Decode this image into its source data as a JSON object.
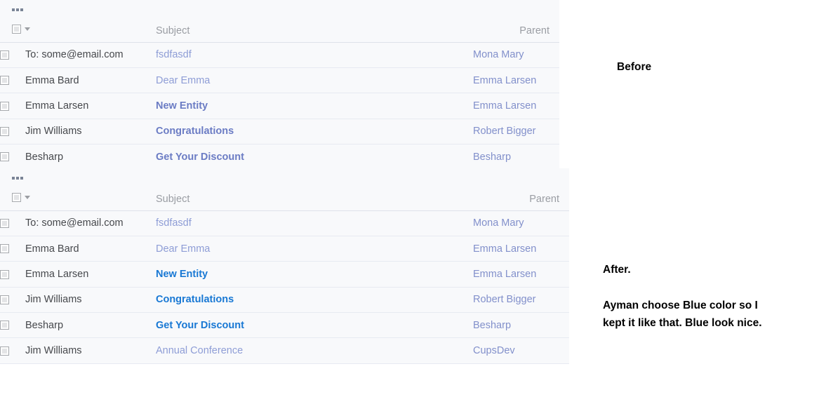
{
  "tables": [
    {
      "id": "before",
      "overflow_icon": "ellipsis-icon",
      "select_all_icon": "checkbox-icon",
      "dropdown_icon": "caret-down-icon",
      "columns": {
        "check": "",
        "from": "",
        "subject": "Subject",
        "parent": "Parent"
      },
      "rows": [
        {
          "from": "To: some@email.com",
          "subject": "fsdfasdf",
          "bold": false,
          "parent": "Mona Mary"
        },
        {
          "from": "Emma Bard",
          "subject": "Dear Emma",
          "bold": false,
          "parent": "Emma Larsen"
        },
        {
          "from": "Emma Larsen",
          "subject": "New Entity",
          "bold": true,
          "parent": "Emma Larsen"
        },
        {
          "from": "Jim Williams",
          "subject": "Congratulations",
          "bold": true,
          "parent": "Robert Bigger"
        },
        {
          "from": "Besharp",
          "subject": "Get Your Discount",
          "bold": true,
          "parent": "Besharp"
        }
      ]
    },
    {
      "id": "after",
      "overflow_icon": "ellipsis-icon",
      "select_all_icon": "checkbox-icon",
      "dropdown_icon": "caret-down-icon",
      "columns": {
        "check": "",
        "from": "",
        "subject": "Subject",
        "parent": "Parent"
      },
      "rows": [
        {
          "from": "To: some@email.com",
          "subject": "fsdfasdf",
          "bold": false,
          "parent": "Mona Mary"
        },
        {
          "from": "Emma Bard",
          "subject": "Dear Emma",
          "bold": false,
          "parent": "Emma Larsen"
        },
        {
          "from": "Emma Larsen",
          "subject": "New Entity",
          "bold": true,
          "parent": "Emma Larsen"
        },
        {
          "from": "Jim Williams",
          "subject": "Congratulations",
          "bold": true,
          "parent": "Robert Bigger"
        },
        {
          "from": "Besharp",
          "subject": "Get Your Discount",
          "bold": true,
          "parent": "Besharp"
        },
        {
          "from": "Jim Williams",
          "subject": "Annual Conference",
          "bold": false,
          "parent": "CupsDev"
        }
      ]
    }
  ],
  "annotations": {
    "before_label": "Before",
    "after_label": "After.",
    "after_note": "Ayman choose Blue color so I kept it like that. Blue look nice."
  },
  "colors": {
    "panel_background": "#f8f9fb",
    "row_divider": "#e7eaf1",
    "header_divider": "#dee2ea",
    "header_text": "#9a9da3",
    "from_text": "#46484c",
    "subject_normal": "#8e9dd6",
    "subject_bold_before": "#6b7cc4",
    "subject_bold_after": "#1878d4",
    "parent_text": "#8290cb",
    "annotation_text": "#000000"
  }
}
